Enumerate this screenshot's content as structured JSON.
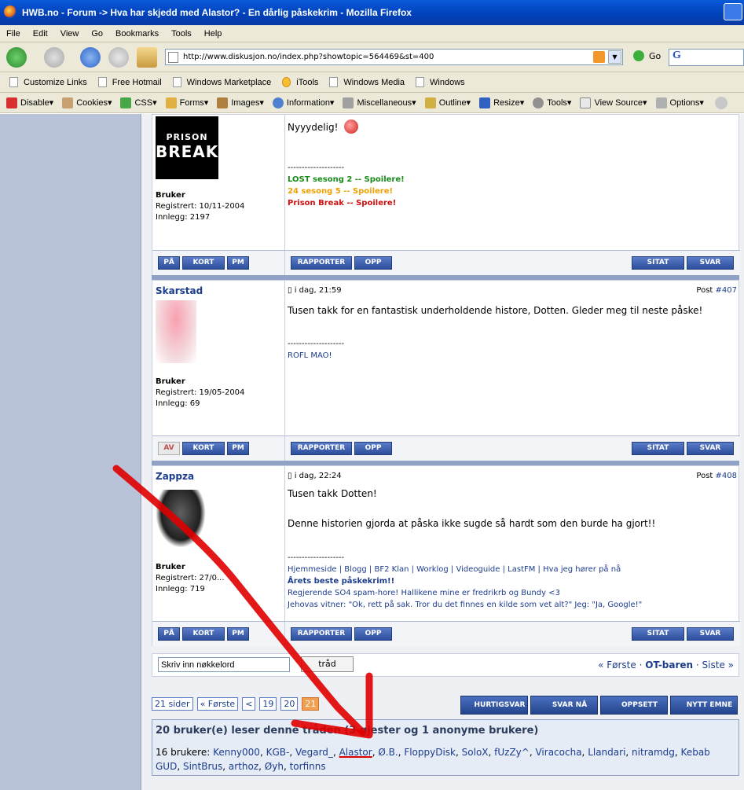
{
  "window": {
    "title": "HWB.no - Forum -> Hva har skjedd med Alastor? - En dårlig påskekrim - Mozilla Firefox"
  },
  "menu": [
    "File",
    "Edit",
    "View",
    "Go",
    "Bookmarks",
    "Tools",
    "Help"
  ],
  "address": {
    "url": "http://www.diskusjon.no/index.php?showtopic=564469&st=400",
    "go_label": "Go"
  },
  "search_engine_icon": "G",
  "bookmarks": [
    "Customize Links",
    "Free Hotmail",
    "Windows Marketplace",
    "iTools",
    "Windows Media",
    "Windows"
  ],
  "devtools": [
    "Disable▾",
    "Cookies▾",
    "CSS▾",
    "Forms▾",
    "Images▾",
    "Information▾",
    "Miscellaneous▾",
    "Outline▾",
    "Resize▾",
    "Tools▾",
    "View Source▾",
    "Options▾"
  ],
  "posts": [
    {
      "avatar_text": [
        "PRISON",
        "BREAK"
      ],
      "role": "Bruker",
      "registered": "Registrert: 10/11-2004",
      "count": "Innlegg: 2197",
      "body": [
        "Nyyydelig!"
      ],
      "sig_dash": "--------------------",
      "sig_lines": [
        "LOST sesong 2 -- Spoilere!",
        "24 sesong 5 -- Spoilere!",
        "Prison Break -- Spoilere!"
      ],
      "buttons_left": [
        "PÅ",
        "KORT",
        "PM"
      ],
      "buttons_mid": [
        "RAPPORTER",
        "OPP"
      ],
      "buttons_right": [
        "SITAT",
        "SVAR"
      ]
    },
    {
      "username": "Skarstad",
      "date": "i dag, 21:59",
      "post_label": "Post ",
      "post_num": "#407",
      "role": "Bruker",
      "registered": "Registrert: 19/05-2004",
      "count": "Innlegg: 69",
      "body": [
        "Tusen takk for en fantastisk underholdende histore, Dotten. Gleder meg til neste påske!"
      ],
      "sig_dash": "--------------------",
      "sig_lines": [
        "ROFL MAO!"
      ],
      "buttons_left": [
        "AV",
        "KORT",
        "PM"
      ],
      "buttons_mid": [
        "RAPPORTER",
        "OPP"
      ],
      "buttons_right": [
        "SITAT",
        "SVAR"
      ]
    },
    {
      "username": "Zappza",
      "date": "i dag, 22:24",
      "post_label": "Post ",
      "post_num": "#408",
      "role": "Bruker",
      "registered": "Registrert: 27/0...",
      "count": "Innlegg: 719",
      "body": [
        "Tusen takk Dotten!",
        "Denne historien gjorda at påska ikke sugde så hardt som den burde ha gjort!!"
      ],
      "sig_dash": "--------------------",
      "sig_lines": [
        "Hjemmeside | Blogg | BF2 Klan | Worklog | Videoguide | LastFM | Hva jeg hører på nå",
        "Årets beste påskekrim!!",
        "Regjerende SO4 spam-hore! Hallikene mine er fredrikrb og Bundy <3",
        "Jehovas vitner: \"Ok, rett på sak. Tror du det finnes en kilde som vet alt?\" Jeg: \"Ja, Google!\""
      ],
      "buttons_left": [
        "PÅ",
        "KORT",
        "PM"
      ],
      "buttons_mid": [
        "RAPPORTER",
        "OPP"
      ],
      "buttons_right": [
        "SITAT",
        "SVAR"
      ]
    }
  ],
  "search": {
    "placeholder": "Skriv inn nøkkelord",
    "button": "tråd"
  },
  "forum_nav": {
    "first": "« Første",
    "sep1": " · ",
    "current": "OT-baren",
    "sep2": " · ",
    "last": "Siste »"
  },
  "pagination": [
    "21 sider",
    "« Første",
    "<",
    "19",
    "20",
    "21"
  ],
  "actions": [
    "HURTIGSVAR",
    "SVAR NÅ",
    "OPPSETT",
    "NYTT EMNE"
  ],
  "readers": {
    "title": "20 bruker(e) leser denne tråden (3 gjester og 1 anonyme brukere)",
    "label": "16 brukere: ",
    "users": [
      "Kenny000",
      "KGB-",
      "Vegard_",
      "Alastor",
      "Ø.B.",
      "FloppyDisk",
      "SoloX",
      "fUzZy^",
      "Viracocha",
      "Llandari",
      "nitramdg",
      "Kebab GUD",
      "SintBrus",
      "arthoz",
      "Øyh",
      "torfinns"
    ]
  },
  "colors": {
    "accent": "#1c3c8c",
    "lost": "#1a8a1a",
    "series24": "#f0a000",
    "prison": "#d01010",
    "annotation": "#e00000"
  }
}
